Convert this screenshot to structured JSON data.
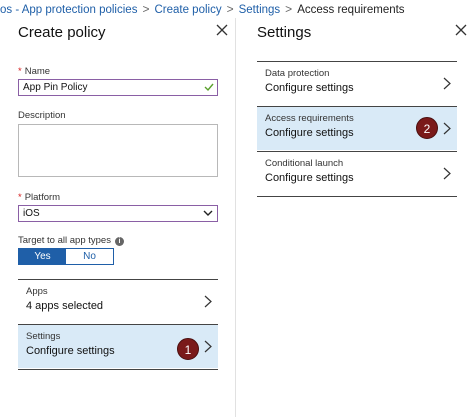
{
  "breadcrumb": {
    "items": [
      "os - App protection policies",
      "Create policy",
      "Settings"
    ],
    "current": "Access requirements",
    "separator": ">"
  },
  "left_panel": {
    "title": "Create policy",
    "name": {
      "label": "Name",
      "value": "App Pin Policy"
    },
    "description": {
      "label": "Description",
      "value": ""
    },
    "platform": {
      "label": "Platform",
      "value": "iOS"
    },
    "target": {
      "label": "Target to all app types",
      "options": [
        "Yes",
        "No"
      ],
      "selected": "Yes"
    },
    "apps": {
      "label": "Apps",
      "value": "4 apps selected"
    },
    "settings": {
      "label": "Settings",
      "value": "Configure settings",
      "badge": "1"
    }
  },
  "right_panel": {
    "title": "Settings",
    "items": [
      {
        "label": "Data protection",
        "value": "Configure settings"
      },
      {
        "label": "Access requirements",
        "value": "Configure settings",
        "badge": "2"
      },
      {
        "label": "Conditional launch",
        "value": "Configure settings"
      }
    ]
  },
  "colors": {
    "link": "#1f5fa8",
    "selected_bg": "#d9eaf7",
    "input_border": "#8a5fa5",
    "badge": "#7a1a1a",
    "required": "#d41b1b",
    "check": "#5aa02c"
  },
  "icons": [
    "close-icon",
    "checkmark-icon",
    "chevron-down-icon",
    "chevron-right-icon",
    "info-icon"
  ]
}
